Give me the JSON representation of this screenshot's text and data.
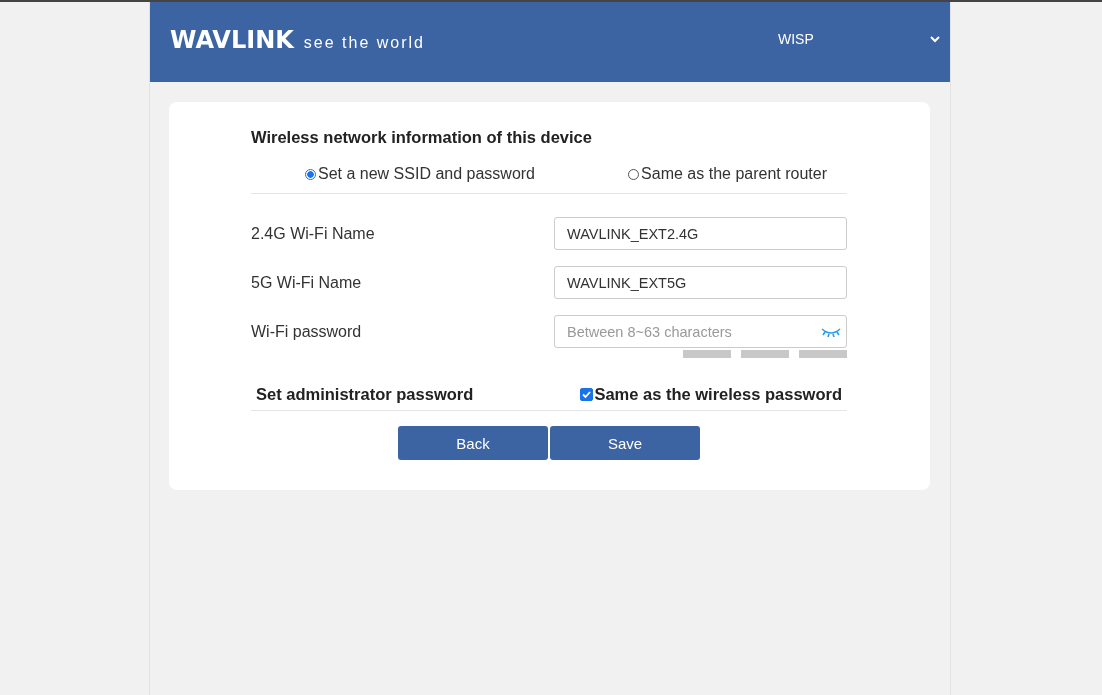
{
  "header": {
    "logo": "WAVLINK",
    "tagline": "see the world",
    "mode": "WISP"
  },
  "section_title": "Wireless network information of this device",
  "options": [
    {
      "label": "Set a new SSID and password",
      "selected": true
    },
    {
      "label": "Same as the parent router",
      "selected": false
    }
  ],
  "fields": [
    {
      "label": "2.4G Wi-Fi Name",
      "value": "WAVLINK_EXT2.4G",
      "kind": "text"
    },
    {
      "label": "5G Wi-Fi Name",
      "value": "WAVLINK_EXT5G",
      "kind": "text"
    },
    {
      "label": "Wi-Fi password",
      "placeholder": "Between 8~63 characters",
      "kind": "password"
    }
  ],
  "admin": {
    "title": "Set administrator password",
    "same_label": "Same as the wireless password",
    "checked": true
  },
  "buttons": [
    "Back",
    "Save"
  ]
}
